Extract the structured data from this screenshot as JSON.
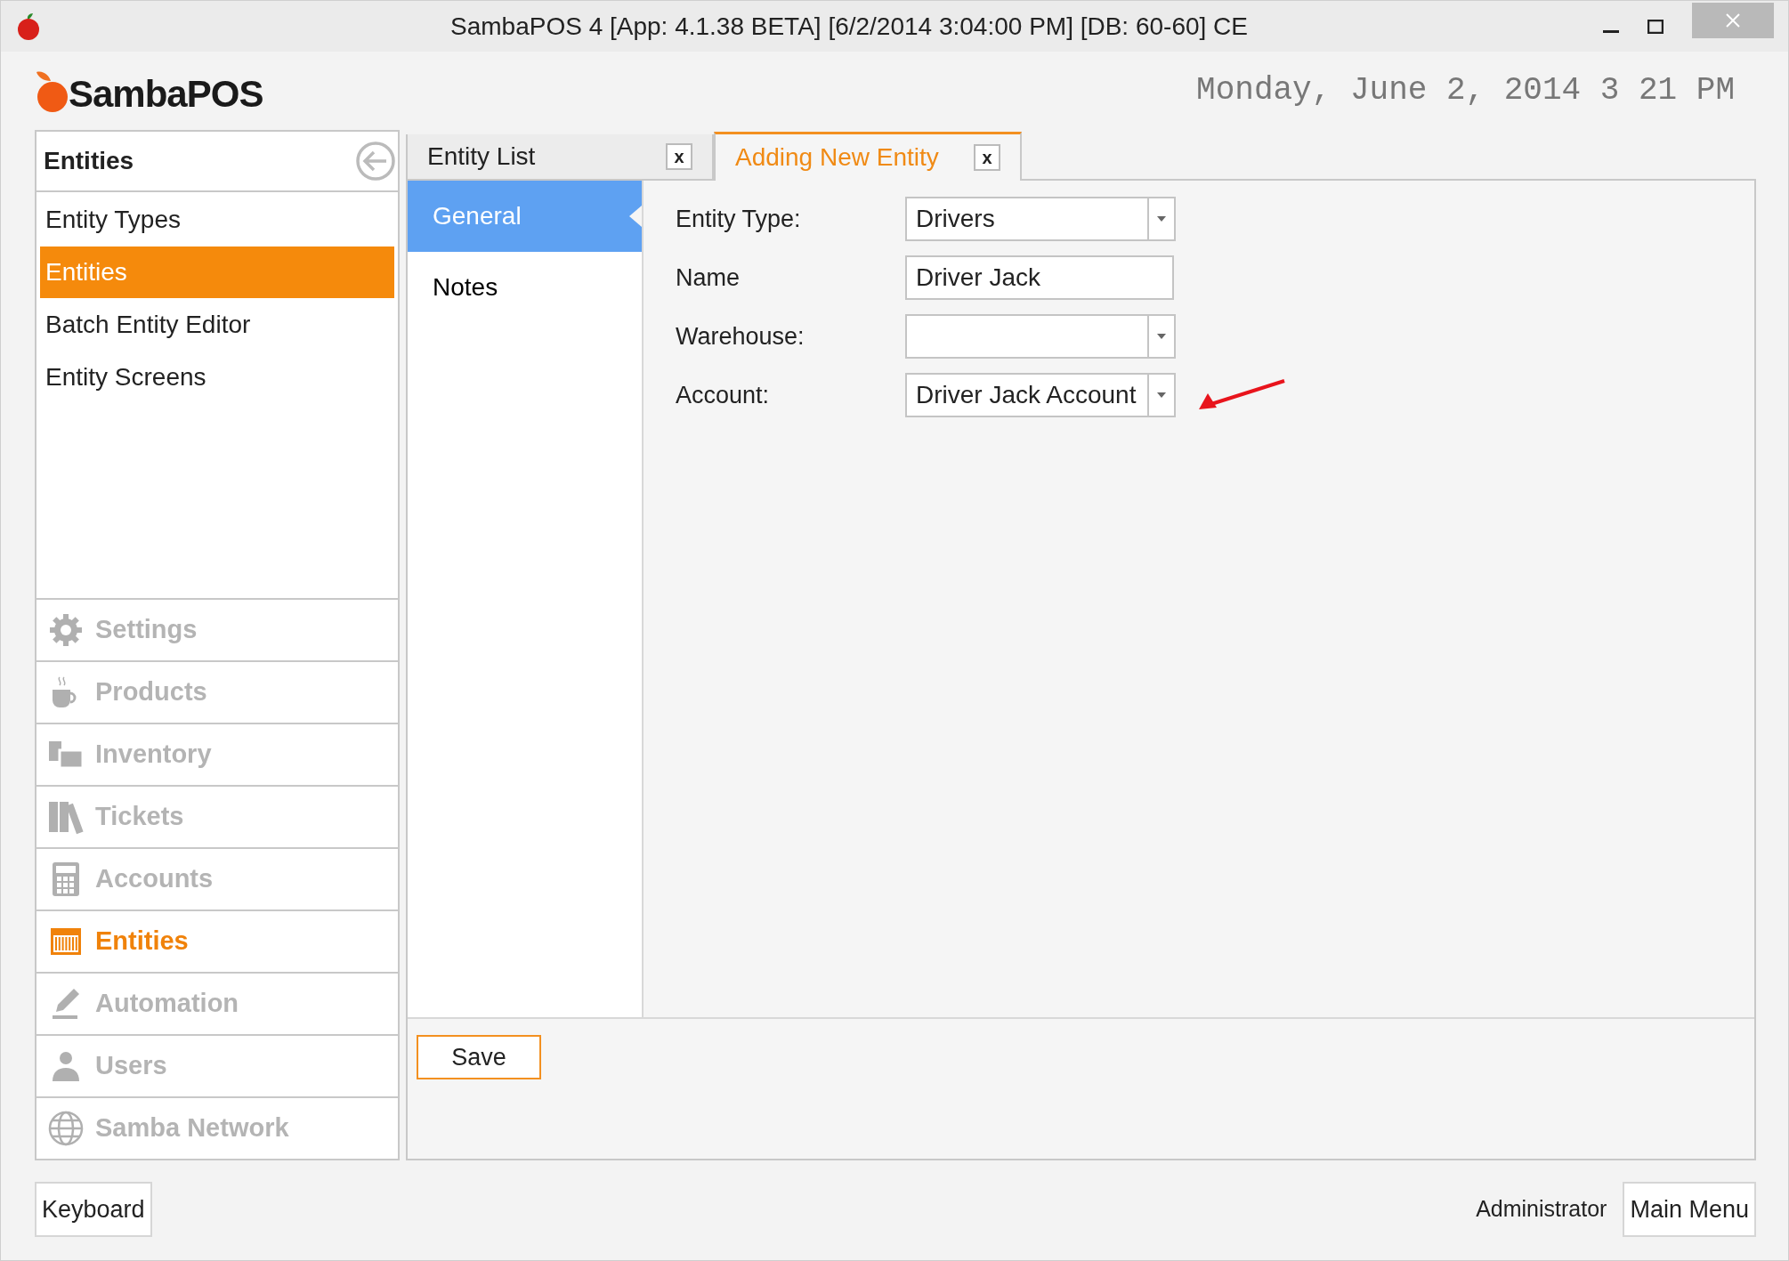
{
  "window": {
    "title": "SambaPOS 4 [App: 4.1.38 BETA] [6/2/2014 3:04:00 PM] [DB: 60-60] CE"
  },
  "logo": {
    "text": "SambaPOS"
  },
  "clock": "Monday, June 2, 2014 3 21 PM",
  "sidebar": {
    "header": "Entities",
    "items": [
      {
        "label": "Entity Types",
        "selected": false
      },
      {
        "label": "Entities",
        "selected": true
      },
      {
        "label": "Batch Entity Editor",
        "selected": false
      },
      {
        "label": "Entity Screens",
        "selected": false
      }
    ],
    "nav": [
      {
        "label": "Settings",
        "selected": false
      },
      {
        "label": "Products",
        "selected": false
      },
      {
        "label": "Inventory",
        "selected": false
      },
      {
        "label": "Tickets",
        "selected": false
      },
      {
        "label": "Accounts",
        "selected": false
      },
      {
        "label": "Entities",
        "selected": true
      },
      {
        "label": "Automation",
        "selected": false
      },
      {
        "label": "Users",
        "selected": false
      },
      {
        "label": "Samba Network",
        "selected": false
      }
    ]
  },
  "tabs": [
    {
      "label": "Entity List",
      "close": "x",
      "selected": false
    },
    {
      "label": "Adding New Entity",
      "close": "x",
      "selected": true
    }
  ],
  "sections": [
    {
      "label": "General",
      "selected": true
    },
    {
      "label": "Notes",
      "selected": false
    }
  ],
  "form": [
    {
      "label": "Entity Type:",
      "kind": "dropdown",
      "value": "Drivers"
    },
    {
      "label": "Name",
      "kind": "text",
      "value": "Driver Jack"
    },
    {
      "label": "Warehouse:",
      "kind": "dropdown"
    },
    {
      "label": "Account:",
      "kind": "dropdown",
      "value": "Driver Jack Account"
    }
  ],
  "save_button": "Save",
  "footer": {
    "keyboard": "Keyboard",
    "user": "Administrator",
    "main_menu": "Main Menu"
  }
}
